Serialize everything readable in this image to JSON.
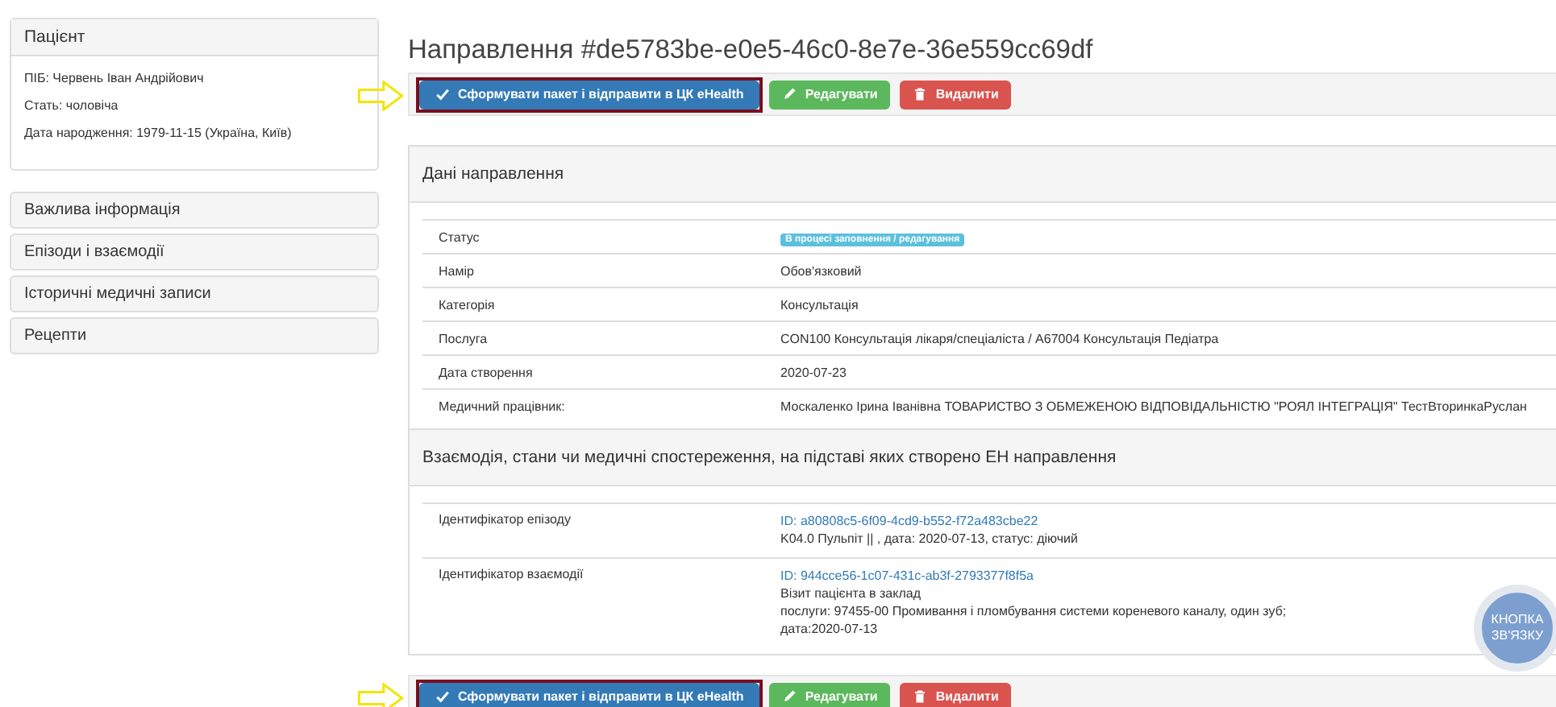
{
  "patient": {
    "title": "Пацієнт",
    "fields": [
      "ПІБ: Червень Іван Андрійович",
      "Стать: чоловіча",
      "Дата народження: 1979-11-15 (Україна, Київ)"
    ]
  },
  "sidebar": {
    "items": [
      "Важлива інформація",
      "Епізоди і взаємодії",
      "Історичні медичні записи",
      "Рецепти"
    ]
  },
  "title": "Направлення #de5783be-e0e5-46c0-8e7e-36e559cc69df",
  "toolbars": [
    {
      "buttons": [
        {
          "kind": "send",
          "label": "Сформувати пакет і відправити в ЦК eHealth",
          "highlighted": true
        },
        {
          "kind": "edit",
          "label": "Редагувати",
          "highlighted": false
        },
        {
          "kind": "delete",
          "label": "Видалити",
          "highlighted": false
        }
      ]
    },
    {
      "buttons": [
        {
          "kind": "send",
          "label": "Сформувати пакет і відправити в ЦК eHealth",
          "highlighted": true
        },
        {
          "kind": "edit",
          "label": "Редагувати",
          "highlighted": false
        },
        {
          "kind": "delete",
          "label": "Видалити",
          "highlighted": false
        }
      ]
    }
  ],
  "details": {
    "title": "Дані направлення",
    "rows": [
      {
        "label": "Статус",
        "value": "В процесі заповнення / редагування",
        "kind": "badge"
      },
      {
        "label": "Намір",
        "value": "Обов'язковий",
        "kind": "text"
      },
      {
        "label": "Категорія",
        "value": "Консультація",
        "kind": "text"
      },
      {
        "label": "Послуга",
        "value": "CON100 Консультація лікаря/спеціаліста / A67004 Консультація Педіатра",
        "kind": "text"
      },
      {
        "label": "Дата створення",
        "value": "2020-07-23",
        "kind": "text"
      },
      {
        "label": "Медичний працівник:",
        "value": "Москаленко Ірина Іванівна ТОВАРИСТВО З ОБМЕЖЕНОЮ ВІДПОВІДАЛЬНІСТЮ \"РОЯЛ ІНТЕГРАЦІЯ\" ТестВторинкаРуслан",
        "kind": "text"
      }
    ]
  },
  "basis": {
    "title": "Взаємодія, стани чи медичні спостереження, на підставі яких створено ЕН направлення",
    "rows": [
      {
        "label": "Ідентифікатор епізоду",
        "link": "ID: a80808c5-6f09-4cd9-b552-f72a483cbe22",
        "lines": [
          "K04.0 Пульпіт || , дата: 2020-07-13, статус: діючий"
        ]
      },
      {
        "label": "Ідентифікатор взаємодії",
        "link": "ID: 944cce56-1c07-431c-ab3f-2793377f8f5a",
        "lines": [
          "Візит пацієнта в заклад",
          "послуги: 97455-00 Промивання і пломбування системи кореневого каналу, один зуб;",
          "дата:2020-07-13"
        ]
      }
    ]
  },
  "contact_button": {
    "label": "КНОПКА ЗВ'ЯЗКУ"
  }
}
